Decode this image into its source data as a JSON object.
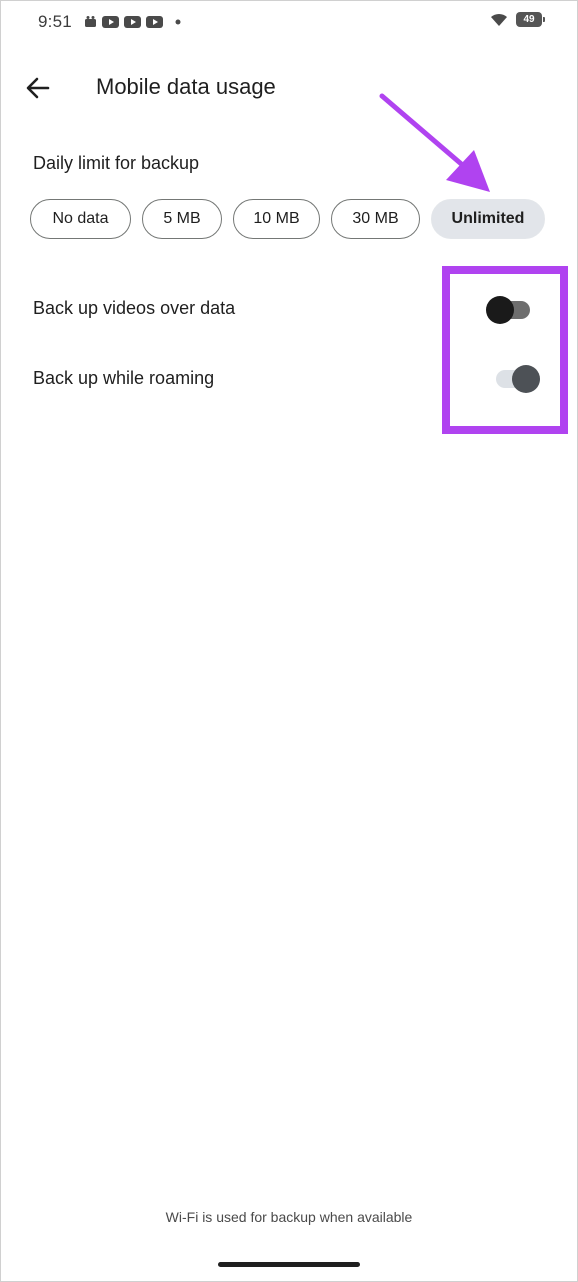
{
  "status_bar": {
    "time": "9:51",
    "notification_icons": [
      "news-icon",
      "youtube-icon",
      "youtube-icon",
      "youtube-icon",
      "dot-icon"
    ],
    "battery_level": "49",
    "wifi": "wifi-icon"
  },
  "header": {
    "back_icon": "arrow-left-icon",
    "title": "Mobile data usage"
  },
  "daily_limit": {
    "label": "Daily limit for backup",
    "options": [
      {
        "label": "No data",
        "selected": false
      },
      {
        "label": "5 MB",
        "selected": false
      },
      {
        "label": "10 MB",
        "selected": false
      },
      {
        "label": "30 MB",
        "selected": false
      },
      {
        "label": "Unlimited",
        "selected": true
      }
    ]
  },
  "settings": [
    {
      "label": "Back up videos over data",
      "enabled": false
    },
    {
      "label": "Back up while roaming",
      "enabled": true
    }
  ],
  "footer": {
    "note": "Wi-Fi is used for backup when available"
  },
  "colors": {
    "annotation": "#b043f0",
    "chip_selected_bg": "#e2e5ea",
    "chip_border": "#747775",
    "switch_off_thumb": "#1a1a1a",
    "switch_off_track": "#6e6e6e",
    "switch_on_thumb": "#4d5156",
    "switch_on_track": "#dde1e6"
  }
}
